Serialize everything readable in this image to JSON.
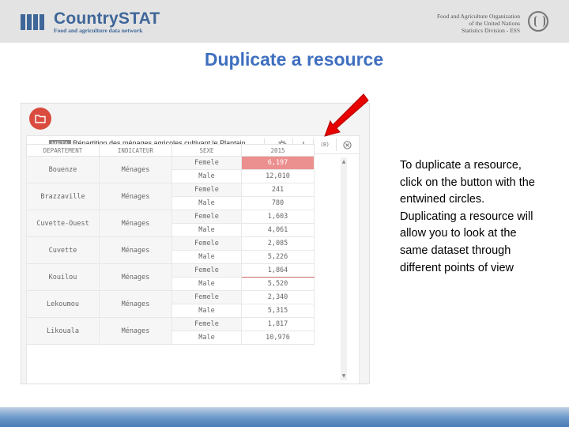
{
  "header": {
    "logo_title": "CountrySTAT",
    "logo_subtitle": "Food and agriculture data network",
    "org_lines": [
      "Food and Agriculture Organization",
      "of the United Nations",
      "Statistics Division - ESS"
    ]
  },
  "slide_title": "Duplicate a resource",
  "screenshot": {
    "meta_badge": "META",
    "resource_title": "Répartition des ménages agricoles cultivant le Plantain ...",
    "toolbar_icons": [
      "gear-icon",
      "download-icon",
      "duplicate-icon",
      "close-icon"
    ],
    "duplicate_label": "(8)",
    "columns": [
      "DEPARTEMENT",
      "INDICATEUR",
      "SEXE",
      "2015"
    ],
    "rows": [
      {
        "dept": "Bouenze",
        "ind": "Ménages",
        "sex": "Femele",
        "val": "6,197"
      },
      {
        "dept": "",
        "ind": "",
        "sex": "Male",
        "val": "12,010"
      },
      {
        "dept": "Brazzaville",
        "ind": "Ménages",
        "sex": "Femele",
        "val": "241"
      },
      {
        "dept": "",
        "ind": "",
        "sex": "Male",
        "val": "780"
      },
      {
        "dept": "Cuvette-Ouest",
        "ind": "Ménages",
        "sex": "Femele",
        "val": "1,603"
      },
      {
        "dept": "",
        "ind": "",
        "sex": "Male",
        "val": "4,061"
      },
      {
        "dept": "Cuvette",
        "ind": "Ménages",
        "sex": "Femele",
        "val": "2,085"
      },
      {
        "dept": "",
        "ind": "",
        "sex": "Male",
        "val": "5,226"
      },
      {
        "dept": "Kouilou",
        "ind": "Ménages",
        "sex": "Femele",
        "val": "1,864"
      },
      {
        "dept": "",
        "ind": "",
        "sex": "Male",
        "val": "5,520"
      },
      {
        "dept": "Lekoumou",
        "ind": "Ménages",
        "sex": "Femele",
        "val": "2,340"
      },
      {
        "dept": "",
        "ind": "",
        "sex": "Male",
        "val": "5,315"
      },
      {
        "dept": "Likouala",
        "ind": "Ménages",
        "sex": "Femele",
        "val": "1,817"
      },
      {
        "dept": "",
        "ind": "",
        "sex": "Male",
        "val": "10,976"
      }
    ],
    "accent_color": "#d94b3e"
  },
  "description": "To duplicate a resource, click on the button with the entwined circles. Duplicating a resource will allow you to look at the same dataset through different points of view",
  "colors": {
    "title": "#3f6fbf",
    "brand": "#3f6699",
    "arrow": "#e60000",
    "highlight_cell": "#ec8f8f"
  }
}
